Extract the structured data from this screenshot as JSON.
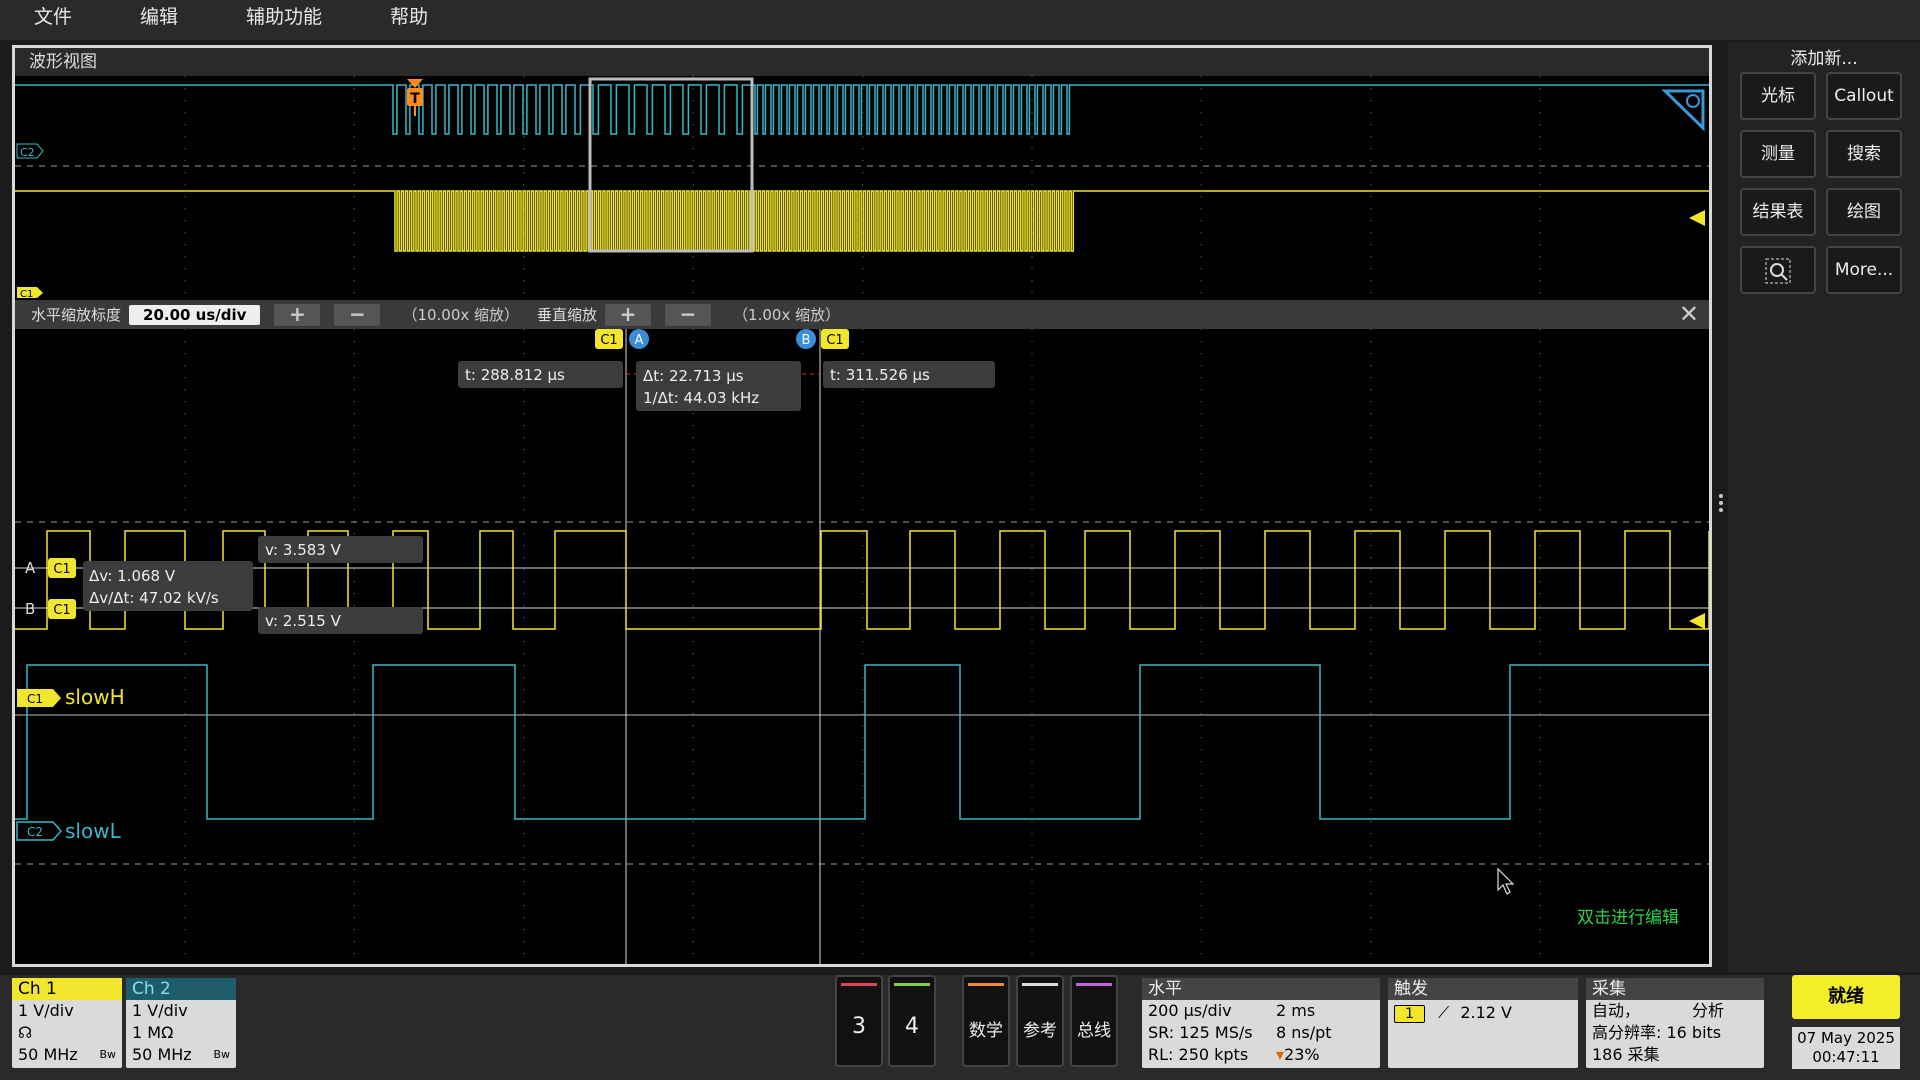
{
  "menu": [
    "文件",
    "编辑",
    "辅助功能",
    "帮助"
  ],
  "waveview": {
    "title": "波形视图"
  },
  "zoom": {
    "h_label": "水平缩放标度",
    "h_value": "20.00 us/div",
    "h_factor": "（10.00x 缩放）",
    "v_label": "垂直缩放",
    "v_factor": "（1.00x 缩放）",
    "plus": "+",
    "minus": "−",
    "close": "✕"
  },
  "cursors": {
    "a_time": "t: 288.812 µs",
    "b_time": "t: 311.526 µs",
    "delta_t": "Δt: 22.713 µs",
    "inv_delta_t": "1/Δt: 44.03 kHz",
    "a_volt": "v: 3.583 V",
    "b_volt": "v: 2.515 V",
    "delta_v": "Δv: 1.068 V",
    "dv_dt": "Δv/Δt: 47.02 kV/s",
    "label_a": "A",
    "label_b": "B",
    "source": "C1"
  },
  "channels": {
    "c1_tag": "C1",
    "c2_tag": "C2",
    "c1_label": "slowH",
    "c2_label": "slowL",
    "trigger_marker": "T",
    "c1_color": "#f2e62c",
    "c2_color": "#3ab7c8"
  },
  "edit_hint": "双击进行编辑",
  "right_panel": {
    "title": "添加新...",
    "buttons": [
      "光标",
      "Callout",
      "测量",
      "搜索",
      "结果表",
      "绘图",
      "zoom-icon",
      "More..."
    ]
  },
  "bottom": {
    "ch1": {
      "title": "Ch 1",
      "scale": "1 V/div",
      "bw": "50 MHz",
      "bw_tag": "Bw"
    },
    "ch2": {
      "title": "Ch 2",
      "scale": "1 V/div",
      "impedance": "1 MΩ",
      "bw": "50 MHz",
      "bw_tag": "Bw"
    },
    "btn3": "3",
    "btn4": "4",
    "math": "数学",
    "ref": "参考",
    "bus": "总线",
    "horizontal": {
      "title": "水平",
      "scale": "200 µs/div",
      "pos": "2 ms",
      "sr": "SR: 125 MS/s",
      "pt": "8 ns/pt",
      "rl": "RL: 250 kpts",
      "pct": "23%"
    },
    "trigger": {
      "title": "触发",
      "source": "1",
      "level": "2.12 V"
    },
    "acq": {
      "title": "采集",
      "mode": "自动，",
      "analyze": "分析",
      "res": "高分辨率: 16 bits",
      "count": "186 采集"
    },
    "ready": "就绪",
    "date": "07 May 2025",
    "time": "00:47:11"
  }
}
